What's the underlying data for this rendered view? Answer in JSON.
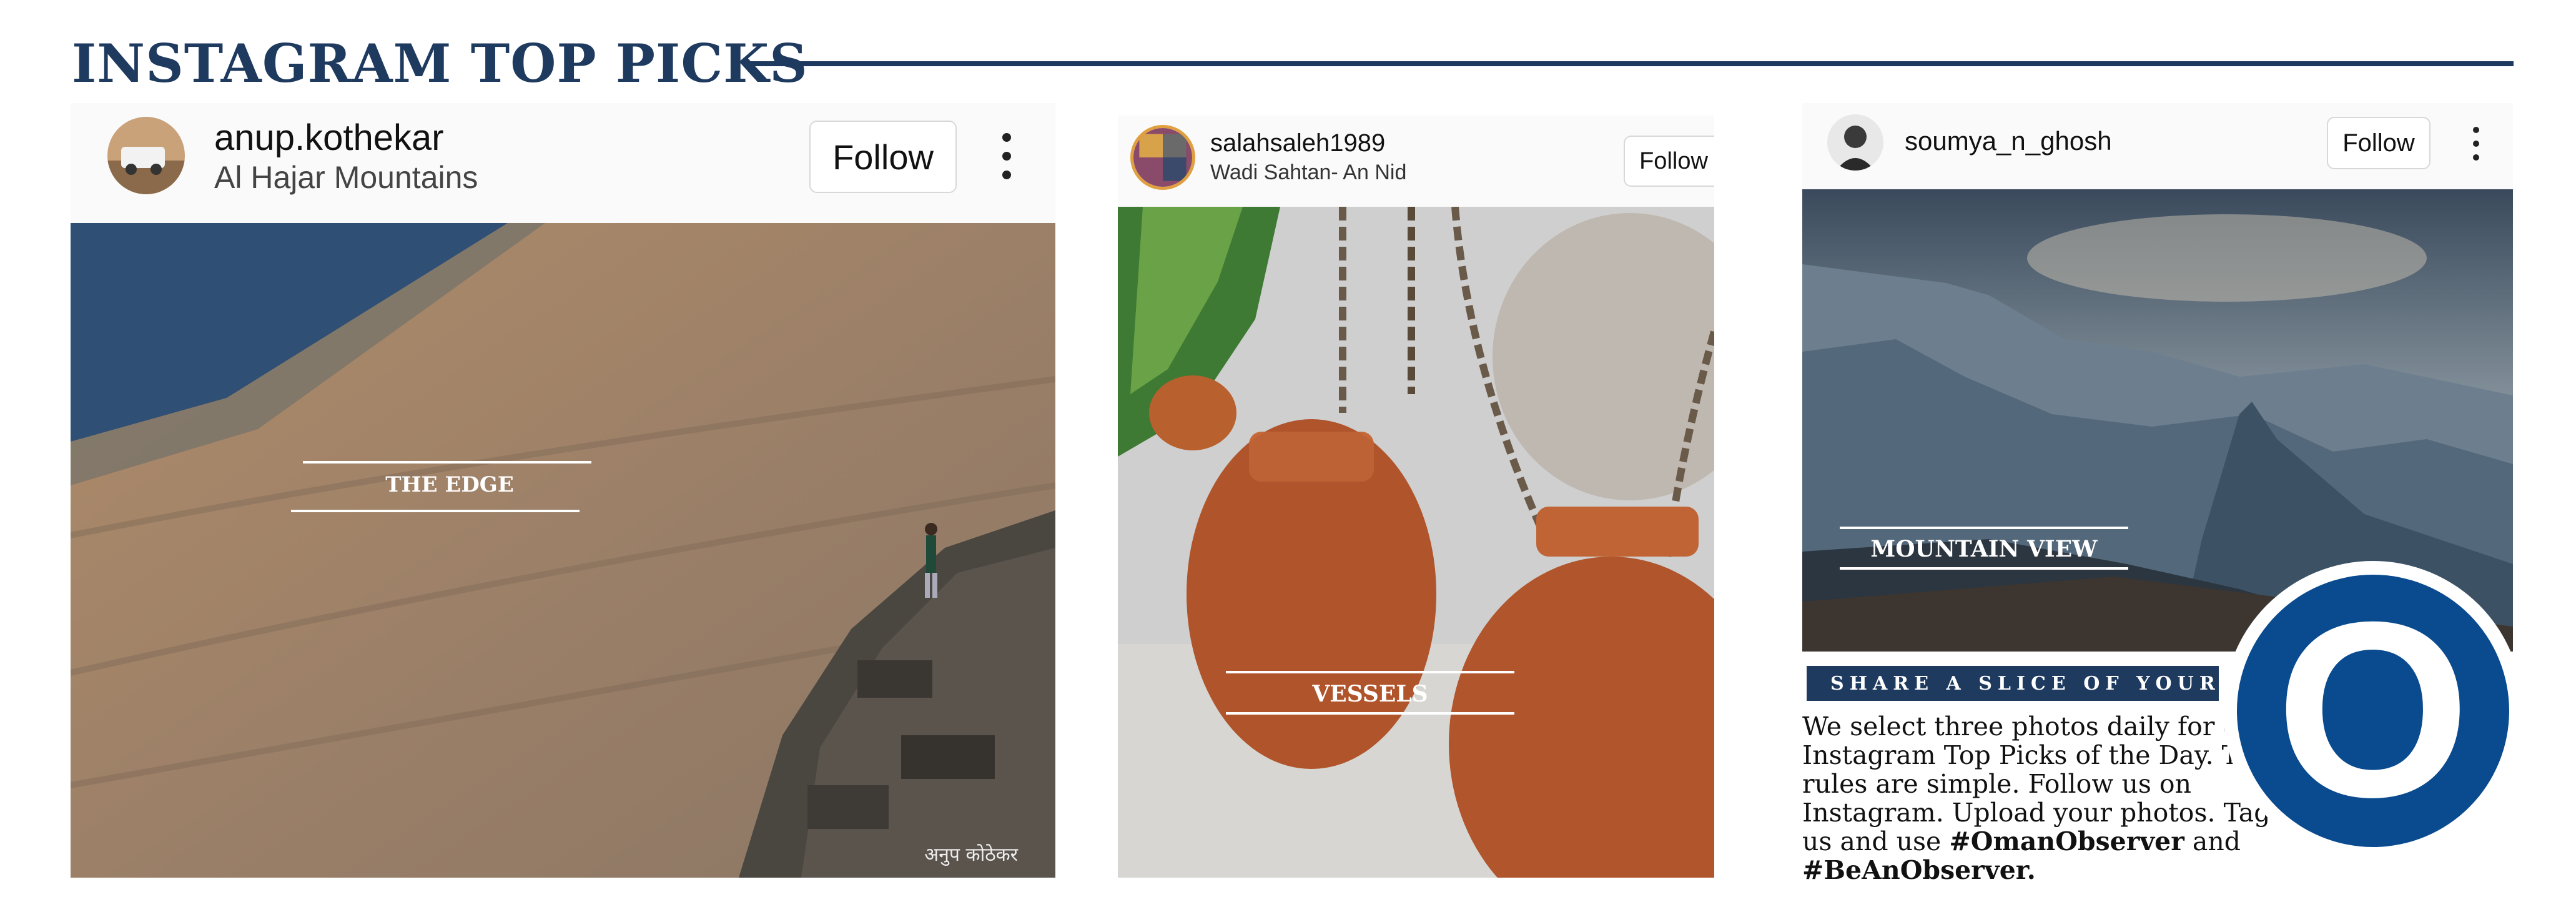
{
  "header": {
    "title": "INSTAGRAM TOP PICKS"
  },
  "posts": [
    {
      "username": "anup.kothekar",
      "location": "Al Hajar Mountains",
      "follow_label": "Follow",
      "caption": "THE EDGE",
      "photo_subject": "hiker standing on rocky cliff edge overlooking mountain slope",
      "watermark": "अनुप कोठेकर"
    },
    {
      "username": "salahsaleh1989",
      "location": "Wadi Sahtan- An Nid",
      "follow_label": "Follow",
      "caption": "VESSELS",
      "photo_subject": "hanging clay pots on chains"
    },
    {
      "username": "soumya_n_ghosh",
      "follow_label": "Follow",
      "caption": "MOUNTAIN VIEW",
      "photo_subject": "misty layered mountain range under cloudy sky"
    }
  ],
  "share": {
    "heading": "SHARE A SLICE OF YOUR LIFE",
    "body": "We select three photos daily for our Instagram Top Picks of the Day. The rules are simple. Follow us on Instagram. Upload your photos. Tag us and use",
    "tag1": "#OmanObserver",
    "conj": "and",
    "tag2": "#BeAnObserver."
  },
  "logo": {
    "letter": "O"
  },
  "colors": {
    "navy": "#1e3a5f",
    "logo_blue": "#0a4b8f"
  }
}
